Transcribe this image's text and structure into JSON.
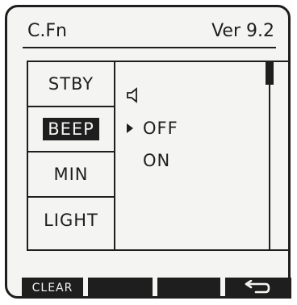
{
  "header": {
    "title": "C.Fn",
    "version": "Ver 9.2"
  },
  "menu": {
    "items": [
      {
        "label": "STBY",
        "selected": false
      },
      {
        "label": "BEEP",
        "selected": true
      },
      {
        "label": "MIN",
        "selected": false
      },
      {
        "label": "LIGHT",
        "selected": false
      }
    ]
  },
  "panel": {
    "icon": "speaker-icon",
    "options": [
      {
        "label": "OFF",
        "selected": true
      },
      {
        "label": "ON",
        "selected": false
      }
    ],
    "cursor_icon": "triangle-right-icon"
  },
  "footer": {
    "buttons": [
      {
        "label": "CLEAR"
      },
      {
        "label": ""
      },
      {
        "label": ""
      },
      {
        "label": "",
        "icon": "return-arrow-icon"
      }
    ]
  },
  "colors": {
    "ink": "#1e1e1e",
    "lcd_background": "#f4f4f2"
  }
}
